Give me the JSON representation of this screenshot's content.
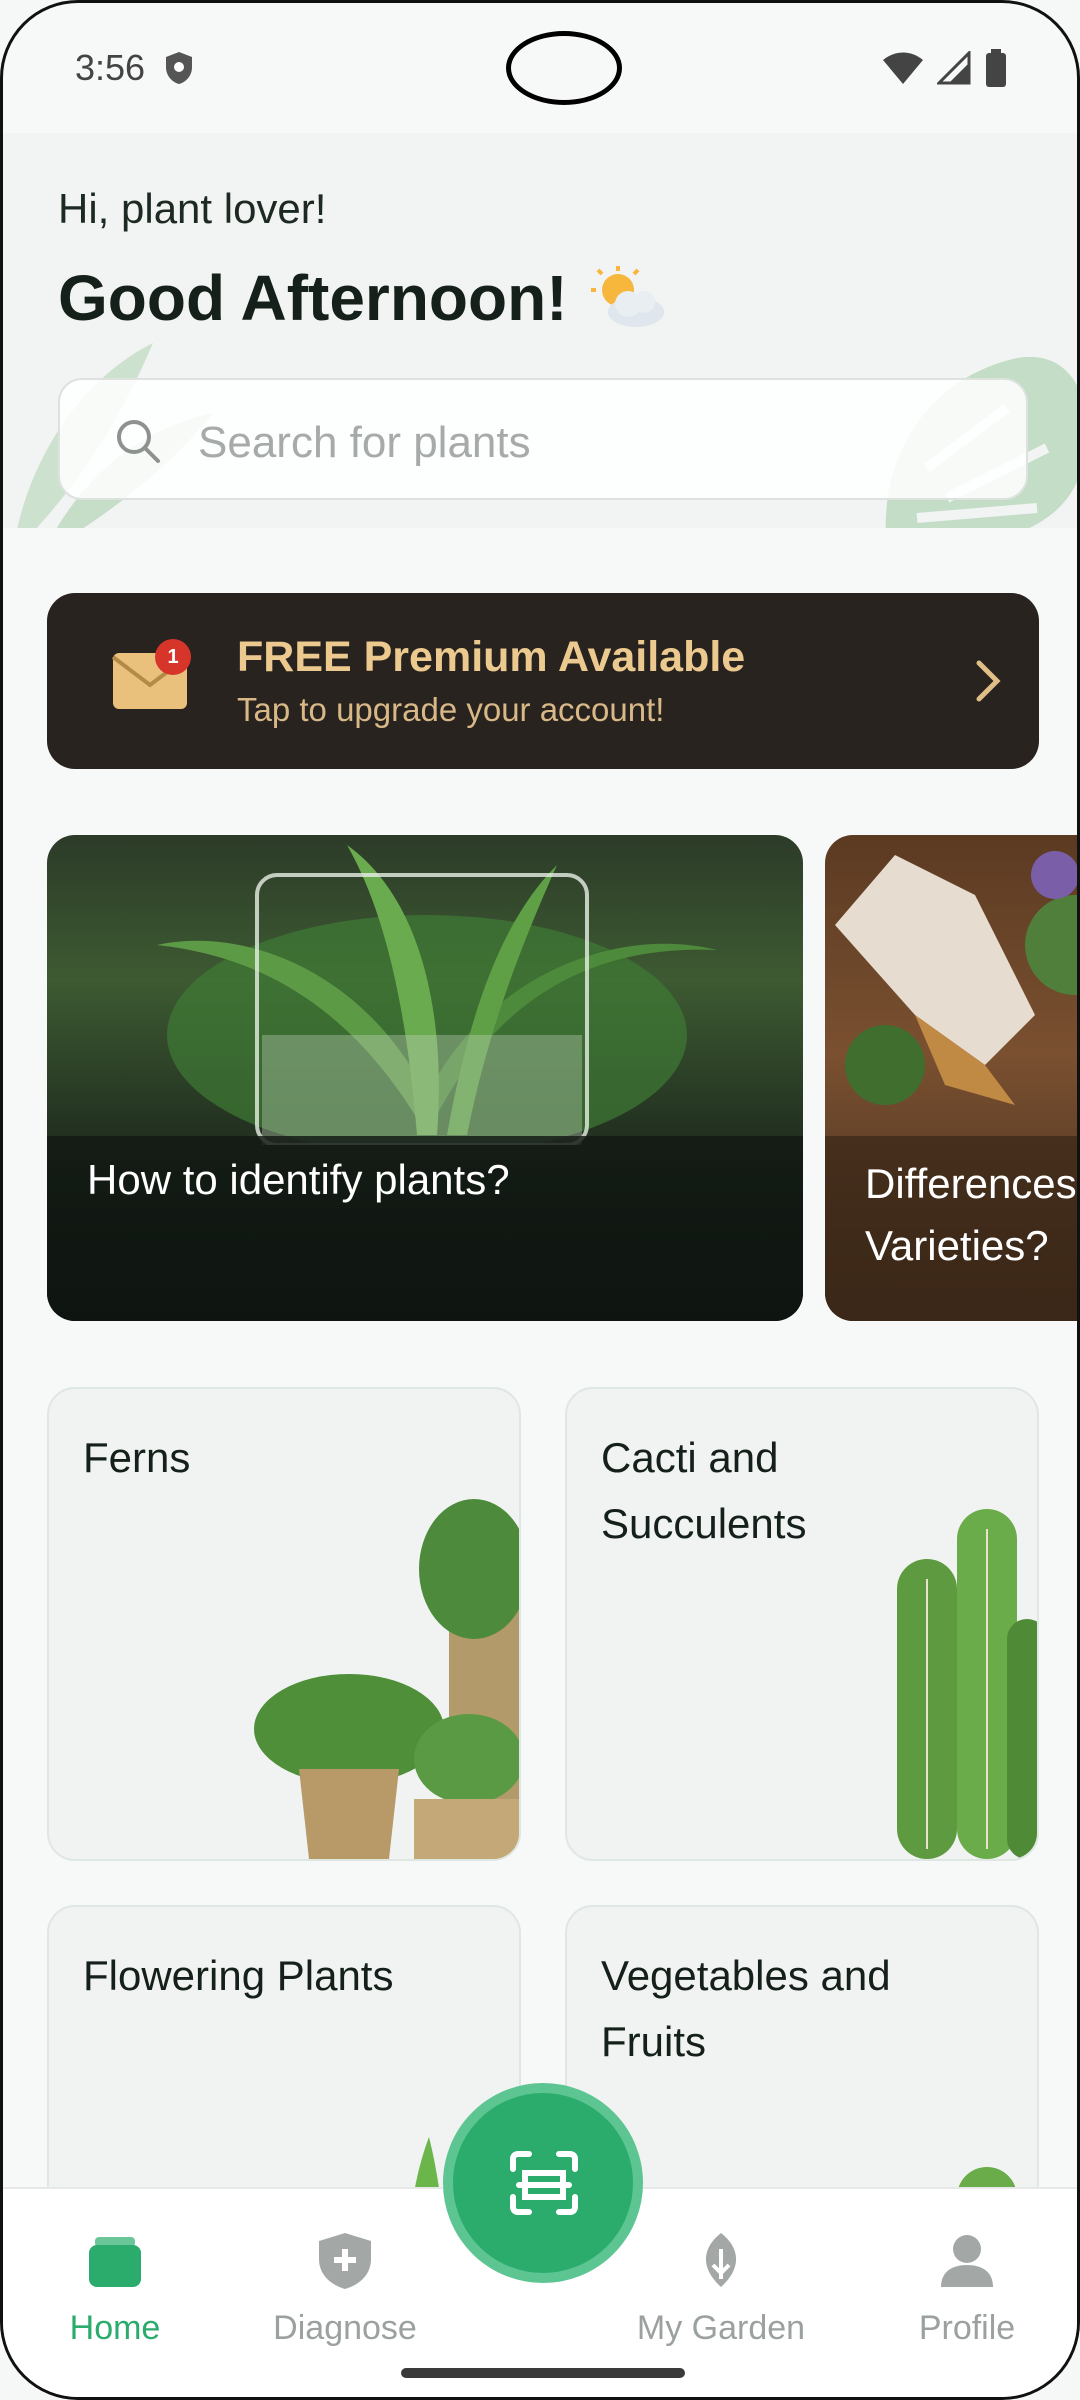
{
  "status_bar": {
    "time": "3:56"
  },
  "header": {
    "hello": "Hi, plant lover!",
    "greeting": "Good Afternoon!",
    "weather_icon": "sun-cloud-icon"
  },
  "search": {
    "placeholder": "Search for plants"
  },
  "promo": {
    "title": "FREE Premium Available",
    "subtitle": "Tap to upgrade your account!",
    "badge": "1"
  },
  "articles": [
    {
      "title": "How to identify plants?"
    },
    {
      "title": "Differences\nVarieties?"
    }
  ],
  "categories": [
    {
      "label": "Ferns"
    },
    {
      "label": "Cacti and Succulents"
    },
    {
      "label": "Flowering Plants"
    },
    {
      "label": "Vegetables and Fruits"
    }
  ],
  "bottom_nav": {
    "items": [
      {
        "label": "Home",
        "icon": "home-icon",
        "active": true
      },
      {
        "label": "Diagnose",
        "icon": "shield-plus-icon"
      },
      {
        "label": "My Garden",
        "icon": "plant-icon"
      },
      {
        "label": "Profile",
        "icon": "person-icon"
      }
    ],
    "scan_icon": "scan-icon"
  },
  "colors": {
    "accent": "#2bac6d",
    "promo_bg": "#28231f",
    "promo_text": "#ebc98f"
  }
}
